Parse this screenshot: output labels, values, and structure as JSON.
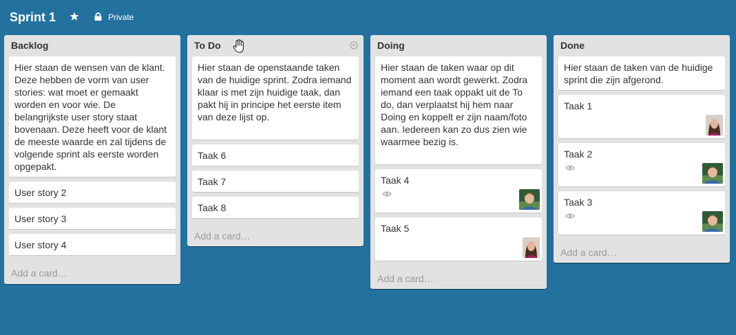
{
  "board": {
    "title": "Sprint 1",
    "visibility": "Private",
    "colors": {
      "background": "#23719f",
      "list": "#e2e2e2",
      "card": "#ffffff"
    }
  },
  "icons": [
    "star-icon",
    "lock-icon",
    "list-menu-icon",
    "eye-icon",
    "hand-cursor-icon"
  ],
  "add_card_label": "Add a card…",
  "lists": [
    {
      "title": "Backlog",
      "cards": [
        {
          "title": "Hier staan de wensen van de klant. Deze hebben de vorm van user stories: wat moet er gemaakt worden en voor wie. De belangrijkste user story staat bovenaan. Deze heeft voor de klant de meeste waarde en zal tijdens de volgende sprint als eerste worden opgepakt."
        },
        {
          "title": "User story 2"
        },
        {
          "title": "User story 3"
        },
        {
          "title": "User story 4"
        }
      ]
    },
    {
      "title": "To Do",
      "cards": [
        {
          "title": "Hier staan de openstaande taken van de huidige sprint. Zodra iemand klaar is met zijn huidige taak, dan pakt hij in principe het eerste item van deze lijst op."
        },
        {
          "title": "Taak 6"
        },
        {
          "title": "Taak 7"
        },
        {
          "title": "Taak 8"
        }
      ]
    },
    {
      "title": "Doing",
      "cards": [
        {
          "title": "Hier staan de taken waar op dit moment aan wordt gewerkt. Zodra iemand een taak oppakt uit de To do, dan verplaatst hij hem naar Doing en koppelt er zijn naam/foto aan. Iedereen kan zo dus zien wie waarmee bezig is."
        },
        {
          "title": "Taak 4"
        },
        {
          "title": "Taak 5"
        }
      ]
    },
    {
      "title": "Done",
      "cards": [
        {
          "title": "Hier staan de taken van de huidige sprint die zijn afgerond."
        },
        {
          "title": "Taak 1"
        },
        {
          "title": "Taak 2"
        },
        {
          "title": "Taak 3"
        }
      ]
    }
  ]
}
